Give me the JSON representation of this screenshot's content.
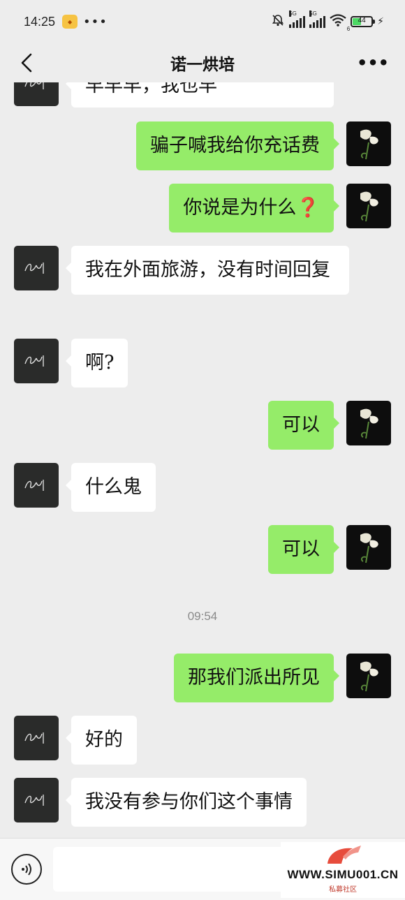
{
  "status_bar": {
    "time": "14:25",
    "network_1": "5G",
    "network_2": "5G",
    "battery": "44",
    "wifi_sub": "6"
  },
  "header": {
    "title": "诺一烘培"
  },
  "messages": [
    {
      "side": "them",
      "text": "早早早，我也早"
    },
    {
      "side": "me",
      "text": "骗子喊我给你充话费"
    },
    {
      "side": "me",
      "text": "你说是为什么",
      "suffix": "❓"
    },
    {
      "side": "them",
      "text": "我在外面旅游，没有时间回复"
    },
    {
      "side": "them",
      "text": "啊?"
    },
    {
      "side": "me",
      "text": "可以"
    },
    {
      "side": "them",
      "text": "什么鬼"
    },
    {
      "side": "me",
      "text": "可以"
    },
    {
      "side": "me",
      "text": "那我们派出所见"
    },
    {
      "side": "them",
      "text": "好的"
    },
    {
      "side": "them",
      "text": "我没有参与你们这个事情"
    }
  ],
  "timestamp": "09:54",
  "watermark": {
    "text": "WWW.SIMU001.CN",
    "sub": "私募社区"
  },
  "colors": {
    "self_bubble": "#95ec69",
    "other_bubble": "#ffffff",
    "background": "#ededed"
  }
}
